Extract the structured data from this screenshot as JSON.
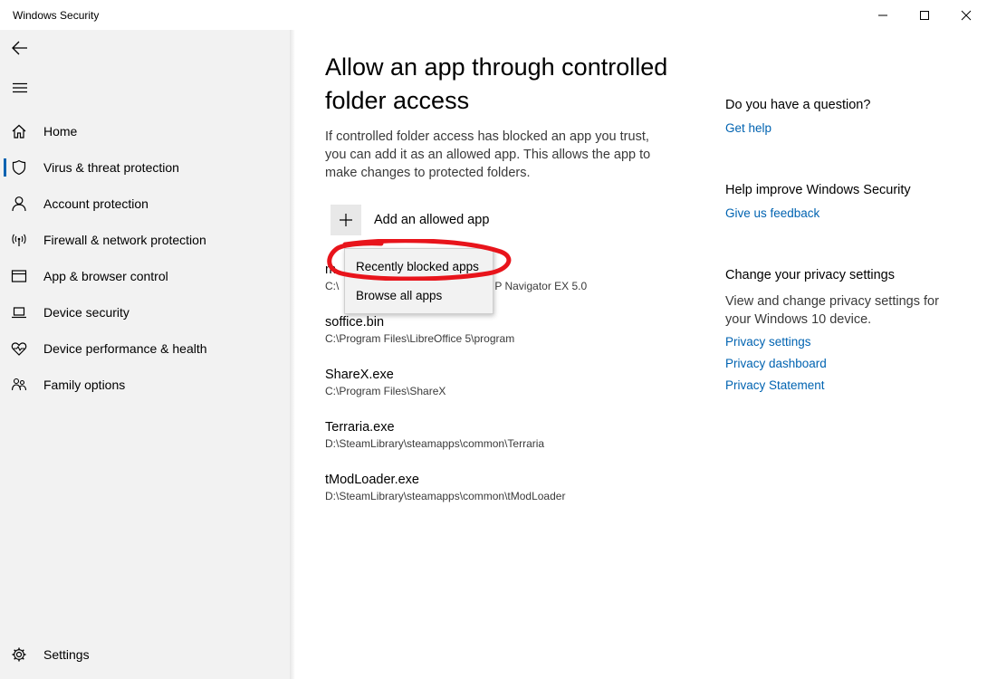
{
  "window": {
    "title": "Windows Security",
    "controls": [
      "minimize",
      "maximize",
      "close"
    ]
  },
  "sidebar": {
    "back_icon": "back-arrow-icon",
    "menu_icon": "hamburger-icon",
    "selected": "Virus & threat protection",
    "items": [
      {
        "label": "Home",
        "icon": "home-icon"
      },
      {
        "label": "Virus & threat protection",
        "icon": "shield-icon"
      },
      {
        "label": "Account protection",
        "icon": "person-icon"
      },
      {
        "label": "Firewall & network protection",
        "icon": "wifi-antenna-icon"
      },
      {
        "label": "App & browser control",
        "icon": "browser-window-icon"
      },
      {
        "label": "Device security",
        "icon": "laptop-icon"
      },
      {
        "label": "Device performance & health",
        "icon": "heart-pulse-icon"
      },
      {
        "label": "Family options",
        "icon": "family-icon"
      }
    ],
    "settings": {
      "label": "Settings",
      "icon": "gear-icon"
    }
  },
  "main": {
    "title_line1": "Allow an app through controlled",
    "title_line2": "folder access",
    "description": "If controlled folder access has blocked an app you trust, you can add it as an allowed app. This allows the app to make changes to protected folders.",
    "add_button": "Add an allowed app",
    "apps": [
      {
        "name": "m",
        "path": "C:\\",
        "path_tail": "P Navigator EX 5.0"
      },
      {
        "name": "soffice.bin",
        "path": "C:\\Program Files\\LibreOffice 5\\program"
      },
      {
        "name": "ShareX.exe",
        "path": "C:\\Program Files\\ShareX"
      },
      {
        "name": "Terraria.exe",
        "path": "D:\\SteamLibrary\\steamapps\\common\\Terraria"
      },
      {
        "name": "tModLoader.exe",
        "path": "D:\\SteamLibrary\\steamapps\\common\\tModLoader"
      }
    ],
    "dropdown": {
      "items": [
        "Recently blocked apps",
        "Browse all apps"
      ],
      "highlighted": "Recently blocked apps",
      "annotation_color": "#e8141b"
    }
  },
  "right": {
    "question": {
      "heading": "Do you have a question?",
      "link": "Get help"
    },
    "improve": {
      "heading": "Help improve Windows Security",
      "link": "Give us feedback"
    },
    "privacy": {
      "heading": "Change your privacy settings",
      "text": "View and change privacy settings for your Windows 10 device.",
      "links": [
        "Privacy settings",
        "Privacy dashboard",
        "Privacy Statement"
      ]
    }
  },
  "colors": {
    "accent": "#0063b1",
    "sidebar": "#f2f2f2",
    "annotation": "#e8141b"
  }
}
